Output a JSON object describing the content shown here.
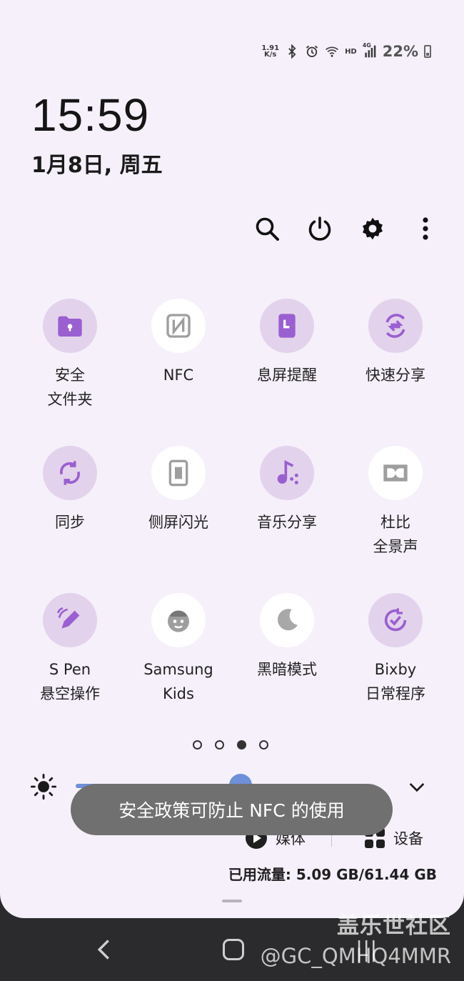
{
  "status_bar": {
    "net_speed_value": "1.91",
    "net_speed_unit": "K/s",
    "network_type": "HD",
    "cell_gen": "4G",
    "battery": "22%",
    "icons": [
      "bluetooth-icon",
      "alarm-icon",
      "wifi-icon",
      "signal-icon",
      "battery-icon"
    ]
  },
  "clock": {
    "time": "15:59",
    "date": "1月8日, 周五"
  },
  "toolbar": {
    "icons": [
      "search-icon",
      "power-icon",
      "settings-icon",
      "more-icon"
    ]
  },
  "tiles": [
    {
      "label": "安全\n文件夹",
      "icon": "secure-folder-icon",
      "active": true
    },
    {
      "label": "NFC",
      "icon": "nfc-icon",
      "active": false
    },
    {
      "label": "息屏提醒",
      "icon": "always-on-display-icon",
      "active": true
    },
    {
      "label": "快速分享",
      "icon": "quick-share-icon",
      "active": true
    },
    {
      "label": "同步",
      "icon": "sync-icon",
      "active": true
    },
    {
      "label": "侧屏闪光",
      "icon": "edge-lighting-icon",
      "active": false
    },
    {
      "label": "音乐分享",
      "icon": "music-share-icon",
      "active": true
    },
    {
      "label": "杜比\n全景声",
      "icon": "dolby-atmos-icon",
      "active": false
    },
    {
      "label": "S Pen\n悬空操作",
      "icon": "spen-air-icon",
      "active": true
    },
    {
      "label": "Samsung\nKids",
      "icon": "samsung-kids-icon",
      "active": false
    },
    {
      "label": "黑暗模式",
      "icon": "dark-mode-icon",
      "active": false
    },
    {
      "label": "Bixby\n日常程序",
      "icon": "bixby-routines-icon",
      "active": true
    }
  ],
  "pager": {
    "pages": 4,
    "current": 3
  },
  "brightness": {
    "level": 0.55
  },
  "toast": {
    "text": "安全政策可防止 NFC 的使用"
  },
  "media": {
    "media_label": "媒体",
    "devices_label": "设备"
  },
  "data_usage": {
    "text": "已用流量: 5.09 GB/61.44 GB"
  },
  "watermark": {
    "title": "盖乐世社区",
    "user": "@GC_QMHQ4MMR"
  },
  "colors": {
    "accent": "#9a5fd1",
    "tile_active_bg": "#e3d2ec",
    "tile_inactive_bg": "#ffffff",
    "panel_bg": "#f5f0fa"
  }
}
